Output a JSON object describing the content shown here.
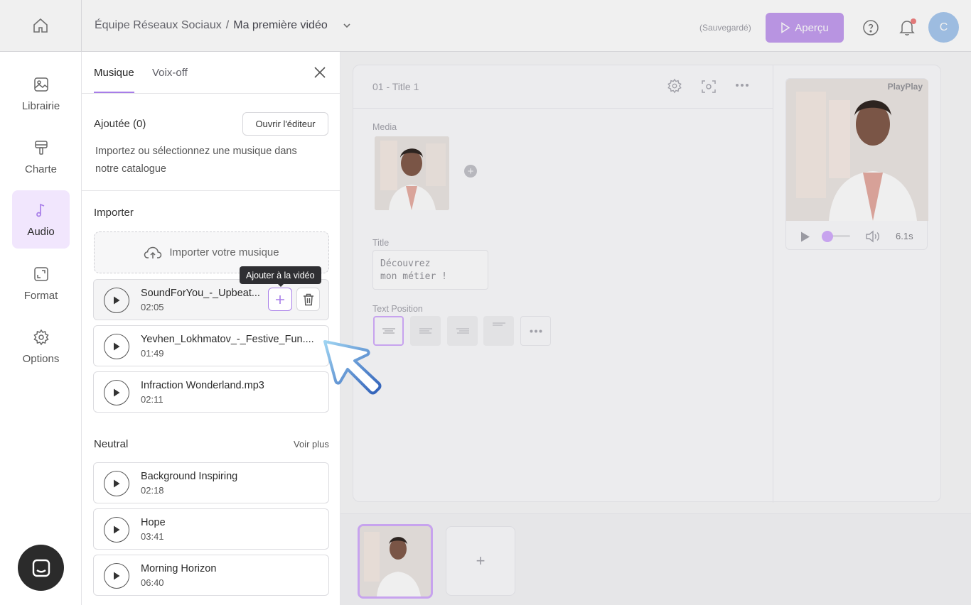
{
  "header": {
    "breadcrumb_team": "Équipe Réseaux Sociaux",
    "breadcrumb_sep": "/",
    "breadcrumb_video": "Ma première vidéo",
    "save_status": "(Sauvegardé)",
    "preview_label": "Aperçu",
    "avatar_initial": "C"
  },
  "rail": {
    "items": [
      {
        "label": "Librairie",
        "icon": "image-icon"
      },
      {
        "label": "Charte",
        "icon": "paint-roller-icon"
      },
      {
        "label": "Audio",
        "icon": "music-note-icon",
        "active": true
      },
      {
        "label": "Format",
        "icon": "resize-icon"
      },
      {
        "label": "Options",
        "icon": "gear-icon"
      }
    ]
  },
  "panel": {
    "tabs": [
      "Musique",
      "Voix-off"
    ],
    "added_title": "Ajoutée (0)",
    "open_editor_label": "Ouvrir l'éditeur",
    "added_description": "Importez ou sélectionnez une musique dans notre catalogue",
    "import_title": "Importer",
    "dropzone_label": "Importer votre musique",
    "tooltip": "Ajouter à la vidéo",
    "imported_tracks": [
      {
        "name": "SoundForYou_-_Upbeat...",
        "duration": "02:05"
      },
      {
        "name": "Yevhen_Lokhmatov_-_Festive_Fun....",
        "duration": "01:49"
      },
      {
        "name": "Infraction Wonderland.mp3",
        "duration": "02:11"
      }
    ],
    "catalog_title": "Neutral",
    "see_more_label": "Voir plus",
    "catalog_tracks": [
      {
        "name": "Background Inspiring",
        "duration": "02:18"
      },
      {
        "name": "Hope",
        "duration": "03:41"
      },
      {
        "name": "Morning Horizon",
        "duration": "06:40"
      }
    ]
  },
  "editor": {
    "scene_title": "01 - Title 1",
    "media_label": "Media",
    "title_label": "Title",
    "title_value": "Découvrez\nmon métier !",
    "text_position_label": "Text Position",
    "preview_watermark": "PlayPlay",
    "preview_duration": "6.1s",
    "timeline_add": "+"
  },
  "colors": {
    "accent": "#a77de8",
    "accent_soft": "#f1e6fd",
    "preview_button": "#c49ef0"
  }
}
